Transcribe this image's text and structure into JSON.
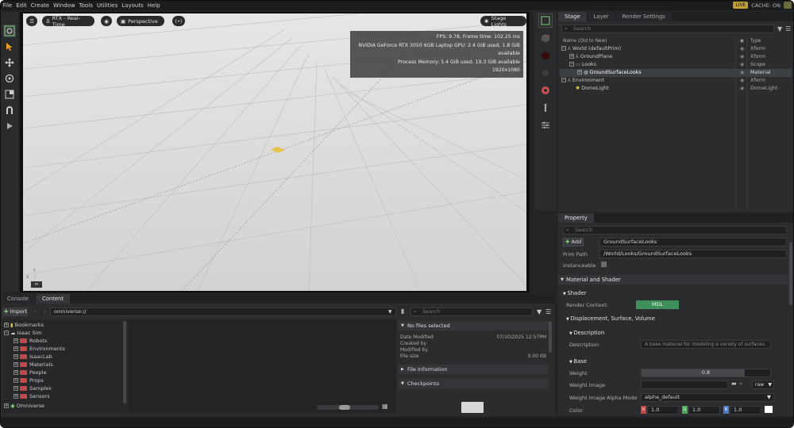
{
  "menubar": {
    "items": [
      "File",
      "Edit",
      "Create",
      "Window",
      "Tools",
      "Utilities",
      "Layouts",
      "Help"
    ],
    "live": "LIVE",
    "cache": "CACHE: ON"
  },
  "viewport": {
    "render_mode": "RTX - Real-Time",
    "camera": "Perspective",
    "stage_lights": "Stage Lights",
    "stats": [
      "FPS: 9.78, Frame time: 102.25 ms",
      "NVIDIA GeForce RTX 3050 6GB Laptop GPU: 2.4 GiB used, 1.8 GiB available",
      "Process Memory: 5.4 GiB used, 19.3 GiB available",
      "1920x1080"
    ],
    "unit_badge": "m",
    "axis_x": "X",
    "axis_y": "Y"
  },
  "stage": {
    "tabs": [
      "Stage",
      "Layer",
      "Render Settings"
    ],
    "search_placeholder": "Search",
    "col_name": "Name (Old to New)",
    "col_type": "Type",
    "rows": [
      {
        "name": "World (defaultPrim)",
        "type": "Xform"
      },
      {
        "name": "GroundPlane",
        "type": "Xform"
      },
      {
        "name": "Looks",
        "type": "Scope"
      },
      {
        "name": "GroundSurfaceLooks",
        "type": "Material"
      },
      {
        "name": "Environment",
        "type": "Xform"
      },
      {
        "name": "DomeLight",
        "type": "DomeLight"
      }
    ]
  },
  "property": {
    "tab": "Property",
    "search_placeholder": "Search",
    "add_label": "Add",
    "name_value": "GroundSurfaceLooks",
    "prim_path_label": "Prim Path",
    "prim_path_value": "/World/Looks/GroundSurfaceLooks",
    "instanceable_label": "Instanceable",
    "section_material": "Material and Shader",
    "section_shader": "Shader",
    "render_context_label": "Render Context:",
    "render_context_value": "MDL",
    "section_displacement": "Displacement, Surface, Volume",
    "section_description": "Description",
    "description_label": "Description",
    "description_value": "A base material for modeling a variety of surfaces.",
    "section_base": "Base",
    "weight_label": "Weight",
    "weight_value": "0.8",
    "weight_image_label": "Weight Image",
    "raw_label": "raw",
    "weight_alpha_label": "Weight Image Alpha Mode",
    "weight_alpha_value": "alpha_default",
    "color_label": "Color",
    "color_values": [
      "1.0",
      "1.0",
      "1.0"
    ],
    "color_channels": [
      "R",
      "G",
      "B"
    ],
    "colors": {
      "r": "#c94444",
      "g": "#4aa85a",
      "b": "#4a7ac9"
    }
  },
  "bottom": {
    "tabs": [
      "Console",
      "Content"
    ],
    "import_label": "Import",
    "path_value": "omniverse://",
    "search_placeholder": "Search",
    "tree": [
      {
        "name": "Bookmarks",
        "level": 0
      },
      {
        "name": "Isaac Sim",
        "level": 0
      },
      {
        "name": "Robots",
        "level": 1
      },
      {
        "name": "Environments",
        "level": 1
      },
      {
        "name": "IsaacLab",
        "level": 1
      },
      {
        "name": "Materials",
        "level": 1
      },
      {
        "name": "People",
        "level": 1
      },
      {
        "name": "Props",
        "level": 1
      },
      {
        "name": "Samples",
        "level": 1
      },
      {
        "name": "Sensors",
        "level": 1
      },
      {
        "name": "Omniverse",
        "level": 0
      }
    ],
    "info": {
      "no_files": "No files selected",
      "date_modified_label": "Date Modified",
      "date_modified_value": "07/10/2025 12:57PM",
      "created_by_label": "Created by",
      "modified_by_label": "Modified by",
      "file_size_label": "File size",
      "file_size_value": "0.00 KB",
      "file_information": "File Information",
      "checkpoints": "Checkpoints"
    }
  }
}
